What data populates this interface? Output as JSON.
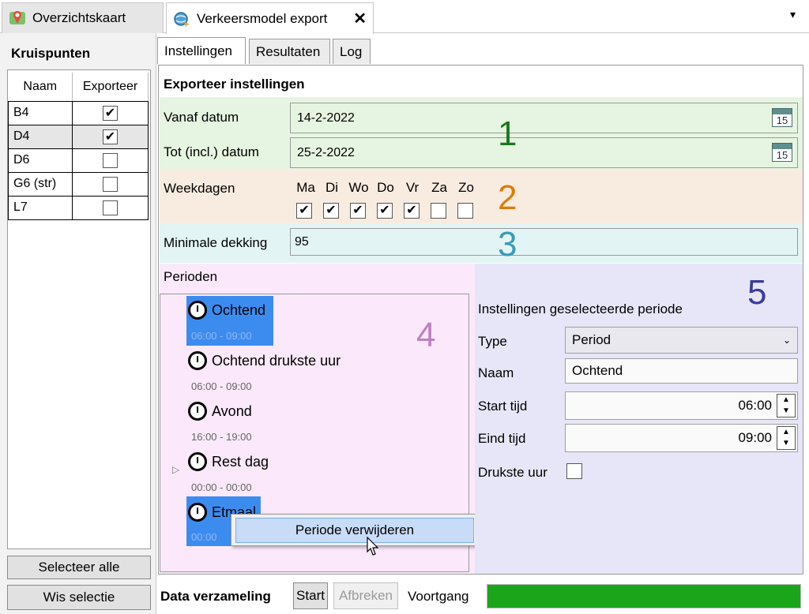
{
  "doc_tabs": [
    {
      "label": "Overzichtskaart",
      "icon": "map-pin-icon"
    },
    {
      "label": "Verkeersmodel export",
      "icon": "globe-export-icon",
      "close": "✕"
    }
  ],
  "overflow_glyph": "▾",
  "kruispunten": {
    "title": "Kruispunten",
    "col_name": "Naam",
    "col_export": "Exporteer",
    "rows": [
      {
        "name": "B4",
        "checked": true
      },
      {
        "name": "D4",
        "checked": true
      },
      {
        "name": "D6",
        "checked": false
      },
      {
        "name": "G6 (str)",
        "checked": false
      },
      {
        "name": "L7",
        "checked": false
      }
    ],
    "select_all": "Selecteer alle",
    "clear_selection": "Wis selectie"
  },
  "inner_tabs": [
    "Instellingen",
    "Resultaten",
    "Log"
  ],
  "settings": {
    "title": "Exporteer instellingen",
    "from_label": "Vanaf datum",
    "from_value": "14-2-2022",
    "to_label": "Tot (incl.) datum",
    "to_value": "25-2-2022",
    "calendar_num": "15",
    "weekdays_label": "Weekdagen",
    "weekdays": [
      {
        "d": "Ma",
        "checked": true
      },
      {
        "d": "Di",
        "checked": true
      },
      {
        "d": "Wo",
        "checked": true
      },
      {
        "d": "Do",
        "checked": true
      },
      {
        "d": "Vr",
        "checked": true
      },
      {
        "d": "Za",
        "checked": false
      },
      {
        "d": "Zo",
        "checked": false
      }
    ],
    "coverage_label": "Minimale dekking",
    "coverage_value": "95",
    "periods_label": "Perioden",
    "markers": {
      "n1": "1",
      "n2": "2",
      "n3": "3",
      "n4": "4",
      "n5": "5"
    },
    "marker_colors": {
      "n1": "#1a7a1a",
      "n2": "#e07b00",
      "n3": "#3a9bb8",
      "n4": "#c080c0",
      "n5": "#3c3c9c"
    }
  },
  "periods": [
    {
      "name": "Ochtend",
      "time": "06:00 - 09:00"
    },
    {
      "name": "Ochtend drukste uur",
      "time": "06:00 - 09:00"
    },
    {
      "name": "Avond",
      "time": "16:00 - 19:00"
    },
    {
      "name": "Rest dag",
      "time": "00:00 - 00:00"
    },
    {
      "name": "Etmaal",
      "time": "00:00"
    }
  ],
  "context_menu": {
    "delete": "Periode verwijderen"
  },
  "selected_period": {
    "title": "Instellingen geselecteerde periode",
    "type_label": "Type",
    "type_value": "Period",
    "name_label": "Naam",
    "name_value": "Ochtend",
    "start_label": "Start tijd",
    "start_value": "06:00",
    "end_label": "Eind tijd",
    "end_value": "09:00",
    "busiest_label": "Drukste uur"
  },
  "bottom": {
    "title": "Data verzameling",
    "start": "Start",
    "abort": "Afbreken",
    "progress_label": "Voortgang",
    "progress": 1.0
  },
  "colors": {
    "zone1": "#e6f5e1",
    "zone2": "#f8ece1",
    "zone3": "#e3f4f4",
    "zone4": "#fbe9fb",
    "zone5": "#e6e6f8",
    "progress": "#1aa51a",
    "selection": "#3c8cf0"
  }
}
